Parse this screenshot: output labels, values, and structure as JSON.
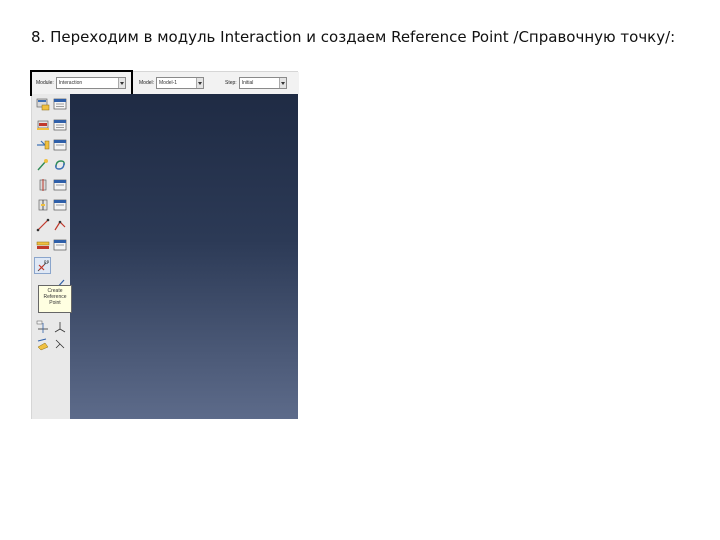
{
  "slide": {
    "title": "8. Переходим в модуль Interaction и создаем Reference Point /Справочную точку/:"
  },
  "context_bar": {
    "module": {
      "label": "Module:",
      "value": "Interaction"
    },
    "model": {
      "label": "Model:",
      "value": "Model-1"
    },
    "step": {
      "label": "Step:",
      "value": "Initial"
    }
  },
  "tooltip": {
    "line1": "Create",
    "line2": "Reference",
    "line3": "Point"
  },
  "colors": {
    "viewport_top": "#1f2b44",
    "viewport_bottom": "#5d6b8a",
    "highlight_border": "#000000"
  }
}
